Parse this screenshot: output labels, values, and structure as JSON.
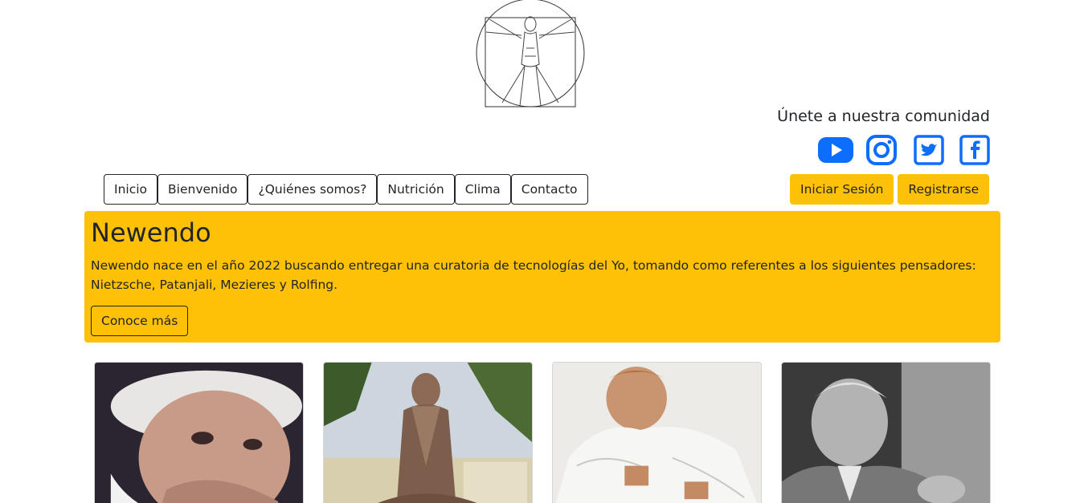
{
  "logo": {
    "icon": "vitruvian-man-logo"
  },
  "community": {
    "title": "Únete a nuestra comunidad"
  },
  "socials": [
    {
      "name": "youtube-icon",
      "color": "#0d6efd"
    },
    {
      "name": "instagram-icon",
      "color": "#0d6efd"
    },
    {
      "name": "twitter-icon",
      "color": "#0d6efd"
    },
    {
      "name": "facebook-icon",
      "color": "#0d6efd"
    }
  ],
  "nav": {
    "items": [
      "Inicio",
      "Bienvenido",
      "¿Quiénes somos?",
      "Nutrición",
      "Clima",
      "Contacto"
    ]
  },
  "auth": {
    "login": "Iniciar Sesión",
    "register": "Registrarse",
    "accent": "#ffc107"
  },
  "hero": {
    "title": "Newendo",
    "text": "Newendo nace en el año 2022 buscando entregar una curatoria de tecnologías del Yo, tomando como referentes a los siguientes pensadores: Nietzsche, Patanjali, Mezieres y Rolfing.",
    "button": "Conoce más"
  },
  "cards": [
    {
      "name": "portrait-elderly-woman"
    },
    {
      "name": "statue-patanjali"
    },
    {
      "name": "man-in-white-coat"
    },
    {
      "name": "elderly-man-portrait"
    }
  ]
}
